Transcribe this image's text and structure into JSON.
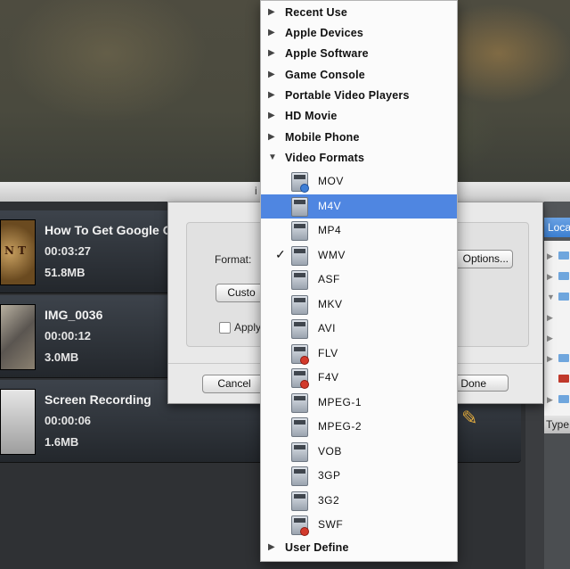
{
  "window": {
    "title": "i"
  },
  "files": [
    {
      "name": "How To Get Google Chrome OS",
      "duration": "00:03:27",
      "size": "51.8MB",
      "thumb_text": "N T"
    },
    {
      "name": "IMG_0036",
      "duration": "00:00:12",
      "size": "3.0MB"
    },
    {
      "name": "Screen Recording",
      "duration": "00:00:06",
      "size": "1.6MB"
    }
  ],
  "right_panel": {
    "location_header": "Loca",
    "type_header": "Type"
  },
  "sheet": {
    "format_label": "Format:",
    "options_button": "Options...",
    "custom_button": "Custo",
    "apply_label": "Apply",
    "cancel_button": "Cancel",
    "done_button": "Done"
  },
  "menu": {
    "categories": [
      "Recent Use",
      "Apple Devices",
      "Apple Software",
      "Game Console",
      "Portable Video Players",
      "HD Movie",
      "Mobile Phone"
    ],
    "expanded_category": "Video Formats",
    "formats": [
      "MOV",
      "M4V",
      "MP4",
      "WMV",
      "ASF",
      "MKV",
      "AVI",
      "FLV",
      "F4V",
      "MPEG-1",
      "MPEG-2",
      "VOB",
      "3GP",
      "3G2",
      "SWF"
    ],
    "highlighted_format": "M4V",
    "checked_format": "WMV",
    "user_define": "User Define"
  },
  "colors": {
    "highlight": "#4f86e1",
    "location_header": "#3c7fd1"
  },
  "icons": {
    "collapsed": "triangle-right-icon",
    "expanded": "triangle-down-icon",
    "check": "checkmark-icon",
    "edit": "pencil-icon"
  }
}
